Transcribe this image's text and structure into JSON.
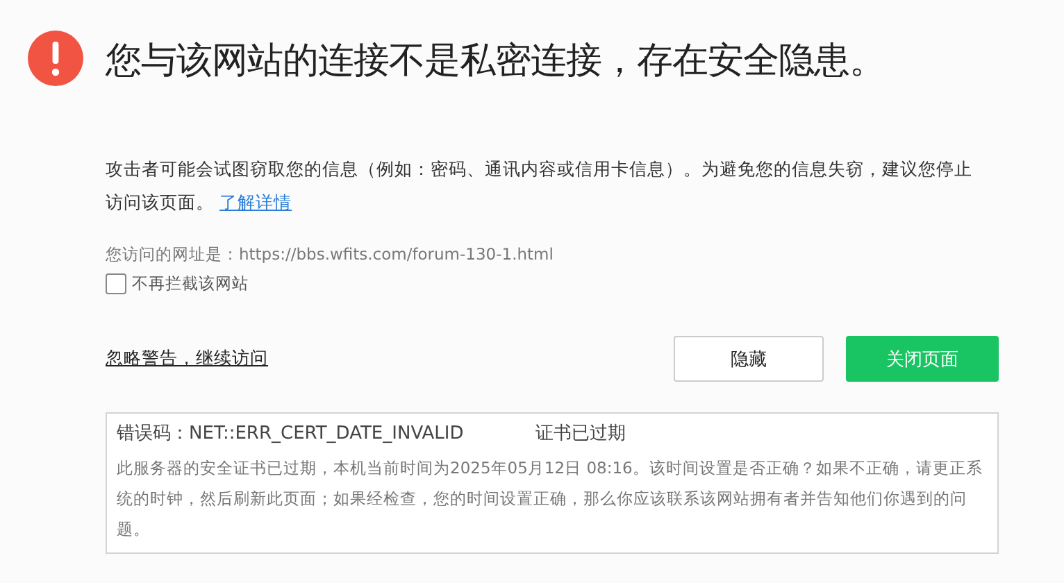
{
  "title": "您与该网站的连接不是私密连接，存在安全隐患。",
  "description": {
    "text": "攻击者可能会试图窃取您的信息（例如：密码、通讯内容或信用卡信息）。为避免您的信息失窃，建议您停止访问该页面。",
    "link": "了解详情"
  },
  "url_line": "您访问的网址是：https://bbs.wfits.com/forum-130-1.html",
  "dont_block": {
    "label": "不再拦截该网站",
    "checked": false
  },
  "proceed_link": "忽略警告，继续访问",
  "buttons": [
    {
      "label": "隐藏",
      "kind": "secondary"
    },
    {
      "label": "关闭页面",
      "kind": "primary"
    }
  ],
  "error": {
    "code": "错误码：NET::ERR_CERT_DATE_INVALID",
    "reason": "证书已过期",
    "detail": "此服务器的安全证书已过期，本机当前时间为2025年05月12日 08:16。该时间设置是否正确？如果不正确，请更正系统的时钟，然后刷新此页面；如果经检查，您的时间设置正确，那么你应该联系该网站拥有者并告知他们你遇到的问题。"
  }
}
